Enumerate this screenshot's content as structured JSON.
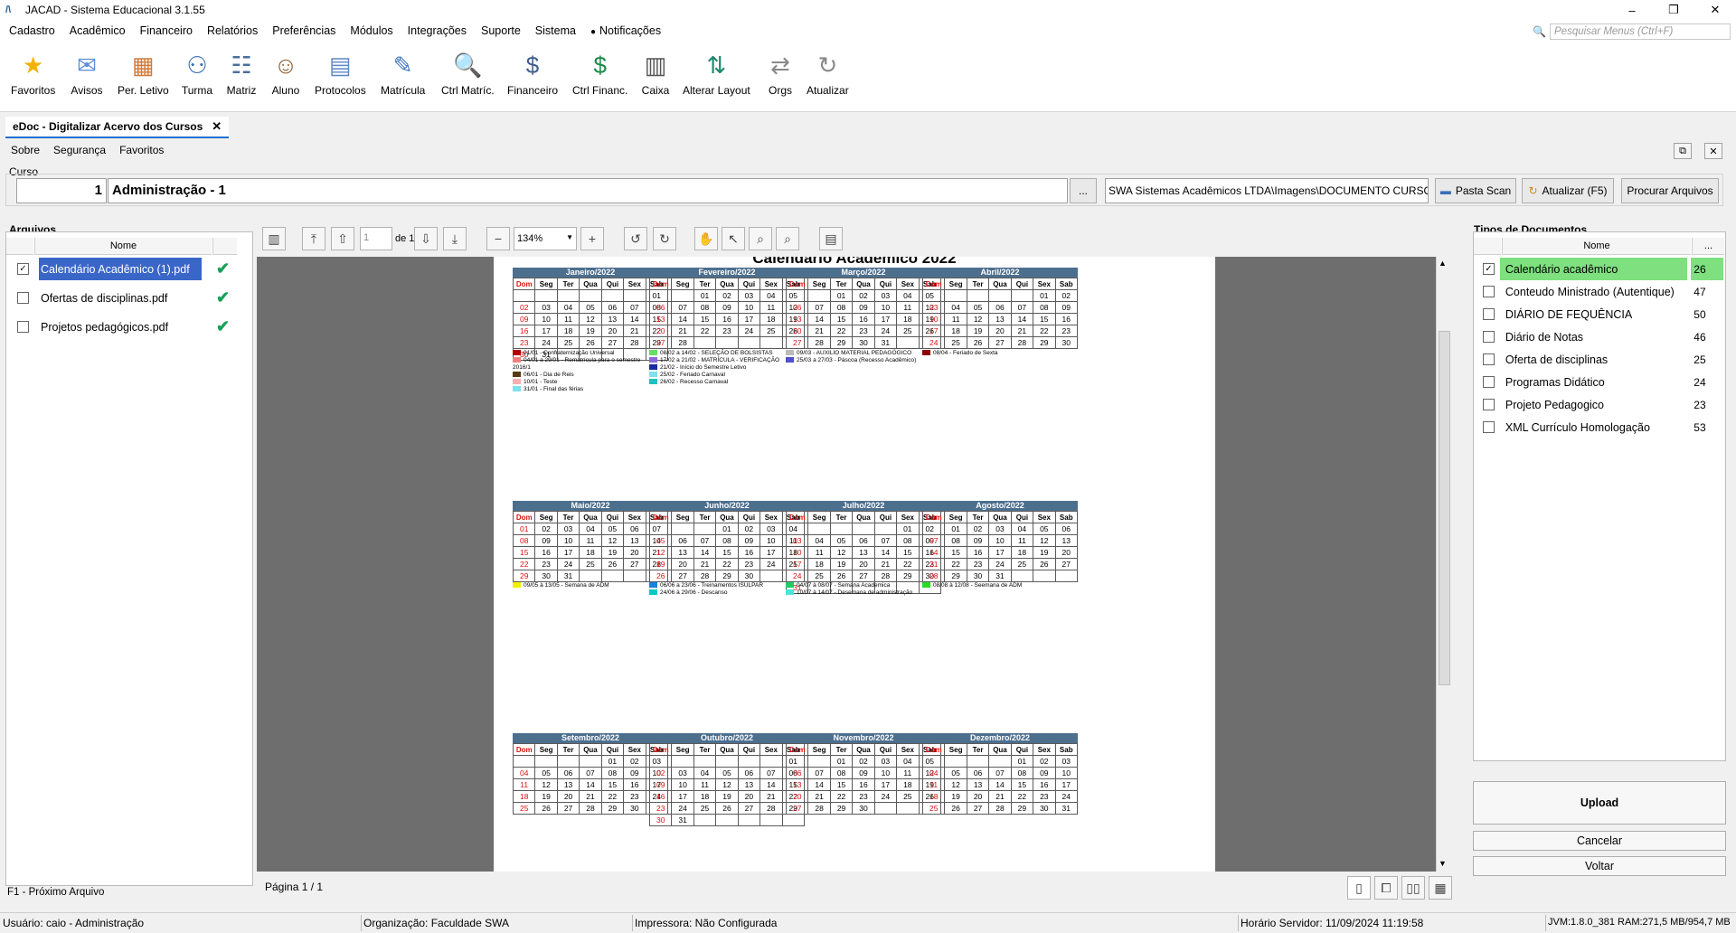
{
  "window": {
    "title": "JACAD - Sistema Educacional 3.1.55",
    "minimize": "–",
    "maximize": "❐",
    "close": "✕"
  },
  "menu": [
    "Cadastro",
    "Acadêmico",
    "Financeiro",
    "Relatórios",
    "Preferências",
    "Módulos",
    "Integrações",
    "Suporte",
    "Sistema"
  ],
  "notifications": "Notificações",
  "search": {
    "placeholder": "Pesquisar Menus (Ctrl+F)"
  },
  "toolbar": [
    {
      "label": "Favoritos",
      "icon": "star-icon"
    },
    {
      "label": "Avisos",
      "icon": "envelope-icon"
    },
    {
      "label": "Per. Letivo",
      "icon": "calendar-icon"
    },
    {
      "label": "Turma",
      "icon": "class-icon"
    },
    {
      "label": "Matriz",
      "icon": "matrix-icon"
    },
    {
      "label": "Aluno",
      "icon": "student-icon"
    },
    {
      "label": "Protocolos",
      "icon": "protocol-icon"
    },
    {
      "label": "Matrícula",
      "icon": "enrollment-icon"
    },
    {
      "label": "Ctrl Matríc.",
      "icon": "enrollment-control-icon"
    },
    {
      "label": "Financeiro",
      "icon": "finance-icon"
    },
    {
      "label": "Ctrl Financ.",
      "icon": "finance-control-icon"
    },
    {
      "label": "Caixa",
      "icon": "cash-register-icon"
    },
    {
      "label": "Alterar Layout",
      "icon": "layout-icon"
    },
    {
      "label": "Orgs",
      "icon": "orgs-icon"
    },
    {
      "label": "Atualizar",
      "icon": "refresh-icon"
    }
  ],
  "tab": {
    "title": "eDoc - Digitalizar Acervo dos Cursos",
    "close": "✕"
  },
  "submenu": [
    "Sobre",
    "Segurança",
    "Favoritos"
  ],
  "curso": {
    "label": "Curso",
    "code": "1",
    "name": "Administração - 1",
    "browse": "...",
    "path": "SWA Sistemas Acadêmicos LTDA\\Imagens\\DOCUMENTO CURSO",
    "pasta_scan": "Pasta Scan",
    "atualizar": "Atualizar (F5)",
    "procurar": "Procurar Arquivos"
  },
  "arquivos": {
    "label": "Arquivos",
    "column": "Nome",
    "files": [
      {
        "name": "Calendário Acadêmico (1).pdf",
        "checked": true,
        "selected": true
      },
      {
        "name": "Ofertas de disciplinas.pdf",
        "checked": false,
        "selected": false
      },
      {
        "name": "Projetos pedagógicos.pdf",
        "checked": false,
        "selected": false
      }
    ],
    "hint": "F1 - Próximo Arquivo"
  },
  "viewer": {
    "page_input": "1",
    "page_of": "de 1",
    "zoom": "134%",
    "page_status": "Página 1 / 1",
    "doc_title": "Calendário Acadêmico 2022"
  },
  "calendar": {
    "weekdays": [
      "Dom",
      "Seg",
      "Ter",
      "Qua",
      "Qui",
      "Sex",
      "Sab"
    ],
    "months": [
      {
        "name": "Janeiro/2022",
        "start": 6,
        "days": 31
      },
      {
        "name": "Fevereiro/2022",
        "start": 2,
        "days": 28
      },
      {
        "name": "Março/2022",
        "start": 2,
        "days": 31
      },
      {
        "name": "Abril/2022",
        "start": 5,
        "days": 30
      },
      {
        "name": "Maio/2022",
        "start": 0,
        "days": 31
      },
      {
        "name": "Junho/2022",
        "start": 3,
        "days": 30
      },
      {
        "name": "Julho/2022",
        "start": 5,
        "days": 31
      },
      {
        "name": "Agosto/2022",
        "start": 1,
        "days": 31
      },
      {
        "name": "Setembro/2022",
        "start": 4,
        "days": 30
      },
      {
        "name": "Outubro/2022",
        "start": 6,
        "days": 31
      },
      {
        "name": "Novembro/2022",
        "start": 2,
        "days": 30
      },
      {
        "name": "Dezembro/2022",
        "start": 4,
        "days": 31
      }
    ],
    "legends": [
      [
        {
          "c": "#b00000",
          "t": "01/01 - Confraternização Universal"
        },
        {
          "c": "#f08080",
          "t": "04/01 a 29/01 - Rematrícula  para o semestre 2016/1"
        },
        {
          "c": "#5a3a14",
          "t": "06/01 - Dia de Reis"
        },
        {
          "c": "#f5b0b0",
          "t": "10/01 - Teste"
        },
        {
          "c": "#7fe0f0",
          "t": "31/01 - Final das férias"
        }
      ],
      [
        {
          "c": "#66dd66",
          "t": "08/02 a 14/02 - SELEÇÃO DE BOLSISTAS"
        },
        {
          "c": "#8a6ad8",
          "t": "17/02 a 21/02 - MATRÍCULA - VERIFICAÇÃO"
        },
        {
          "c": "#1a2aa0",
          "t": "21/02 - Início do Semestre Letivo"
        },
        {
          "c": "#7fe0f0",
          "t": "25/02 - Feriado Carnaval"
        },
        {
          "c": "#22c0c0",
          "t": "26/02 - Recesso Carnaval"
        }
      ],
      [
        {
          "c": "#bbbbbb",
          "t": "09/03 - AUXILIO MATERIAL PEDAGÓGICO"
        },
        {
          "c": "#5050d0",
          "t": "25/03 a 27/03 - Páscoa (Recesso Acadêmico)"
        }
      ],
      [
        {
          "c": "#8b0000",
          "t": "08/04 - Feriado de Sexta"
        }
      ],
      [
        {
          "c": "#f0f000",
          "t": "09/05 à 13/05 - Semana de ADM"
        }
      ],
      [
        {
          "c": "#1a80e0",
          "t": "06/06 a 23/06 - Treinamentos ISULPAR"
        },
        {
          "c": "#00c8c8",
          "t": "24/06 à 29/06 - Descanso"
        }
      ],
      [
        {
          "c": "#22cc66",
          "t": "04/07 à 08/07 - Semana Academica"
        },
        {
          "c": "#44e8d8",
          "t": "10/07 à 14/07 - Desemana de administração"
        }
      ],
      [
        {
          "c": "#22dd22",
          "t": "08/08 à 12/08 - Seemana de ADM"
        }
      ]
    ]
  },
  "tipos": {
    "label": "Tipos de Documentos",
    "column": "Nome",
    "column_more": "...",
    "items": [
      {
        "name": "Calendário acadêmico",
        "count": "26",
        "checked": true,
        "highlight": true
      },
      {
        "name": "Conteudo Ministrado (Autentique)",
        "count": "47",
        "checked": false
      },
      {
        "name": "DIÁRIO DE FEQUÊNCIA",
        "count": "50",
        "checked": false
      },
      {
        "name": "Diário de Notas",
        "count": "46",
        "checked": false
      },
      {
        "name": "Oferta de disciplinas",
        "count": "25",
        "checked": false
      },
      {
        "name": "Programas Didático",
        "count": "24",
        "checked": false
      },
      {
        "name": "Projeto Pedagogico",
        "count": "23",
        "checked": false
      },
      {
        "name": "XML Currículo Homologação",
        "count": "53",
        "checked": false
      }
    ],
    "upload": "Upload",
    "cancelar": "Cancelar",
    "voltar": "Voltar"
  },
  "status": {
    "usuario": "Usuário: caio - Administração",
    "organizacao": "Organização: Faculdade SWA",
    "impressora": "Impressora: Não Configurada",
    "horario": "Horário Servidor: 11/09/2024 11:19:58",
    "jvm": "JVM:1.8.0_381  RAM:271,5 MB/954,7 MB"
  },
  "colors": {
    "accent": "#1d6fd0",
    "selected_row": "#3a66c8",
    "tipo_highlight": "#7ee07e",
    "calendar_header": "#4d6f8e"
  }
}
